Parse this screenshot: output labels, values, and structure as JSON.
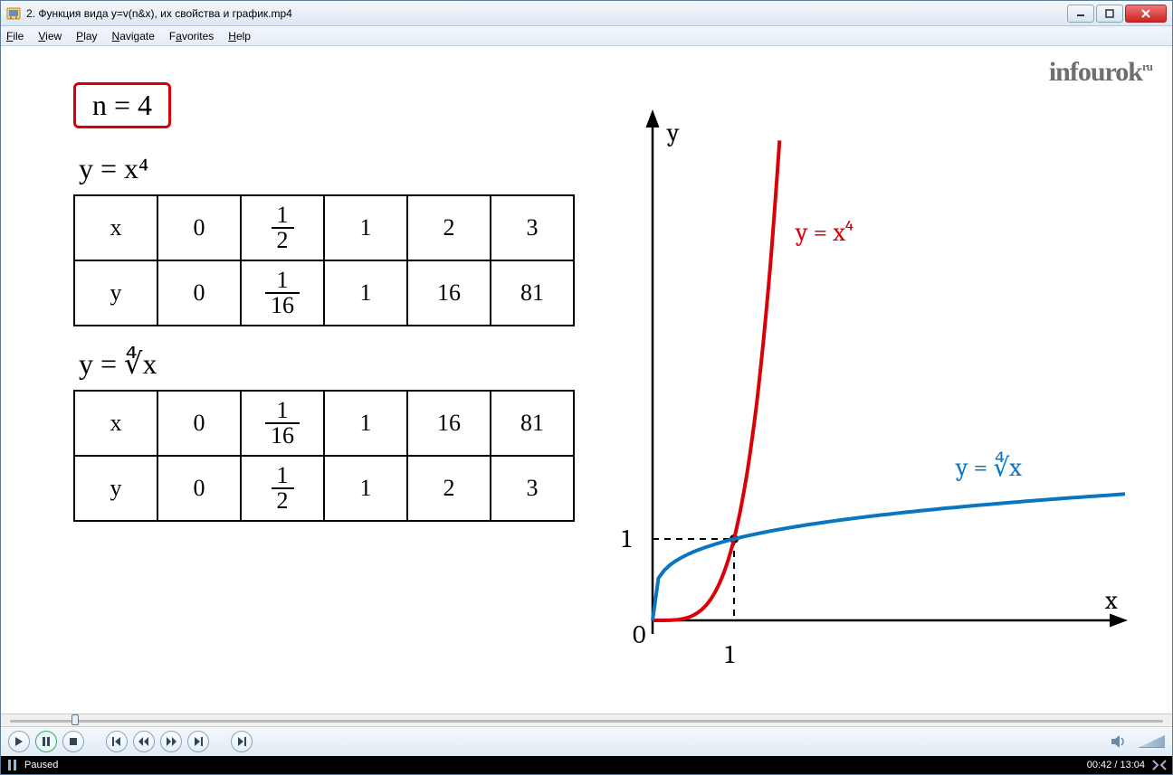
{
  "window": {
    "title": "2. Функция вида y=v(n&x), их свойства и график.mp4"
  },
  "menu": {
    "file": "File",
    "view": "View",
    "play": "Play",
    "navigate": "Navigate",
    "favorites": "Favorites",
    "help": "Help"
  },
  "brand": "infourok",
  "brand_sup": "ru",
  "lesson": {
    "n_box": "n = 4",
    "formula1": "y = x⁴",
    "formula2": "y = ∜x",
    "table1": {
      "row_x": [
        "x",
        "0",
        "1/2",
        "1",
        "2",
        "3"
      ],
      "row_y": [
        "y",
        "0",
        "1/16",
        "1",
        "16",
        "81"
      ]
    },
    "table2": {
      "row_x": [
        "x",
        "0",
        "1/16",
        "1",
        "16",
        "81"
      ],
      "row_y": [
        "y",
        "0",
        "1/2",
        "1",
        "2",
        "3"
      ]
    }
  },
  "graph": {
    "y_label": "y",
    "x_label": "x",
    "origin": "0",
    "tick1x": "1",
    "tick1y": "1",
    "curve1_label": "y = x⁴",
    "curve2_label": "y = ∜x"
  },
  "status": {
    "state": "Paused",
    "time": "00:42 / 13:04"
  },
  "seek_percent": 5.4,
  "chart_data": {
    "type": "line",
    "title": "",
    "xlabel": "x",
    "ylabel": "y",
    "series": [
      {
        "name": "y = x^4",
        "color": "#d9000a",
        "x": [
          0,
          0.25,
          0.5,
          0.75,
          1,
          1.05,
          1.1,
          1.15
        ],
        "y": [
          0,
          0.0039,
          0.0625,
          0.3164,
          1,
          1.2155,
          1.4641,
          1.749
        ]
      },
      {
        "name": "y = x^(1/4)",
        "color": "#0a76c2",
        "x": [
          0,
          0.0625,
          0.25,
          0.5,
          1,
          2,
          4,
          6,
          8
        ],
        "y": [
          0,
          0.5,
          0.7071,
          0.8409,
          1,
          1.1892,
          1.4142,
          1.5651,
          1.6818
        ]
      }
    ],
    "xlim": [
      0,
      8
    ],
    "ylim": [
      0,
      8
    ],
    "annotations": [
      {
        "label": "y = x^4",
        "x": 1.1,
        "y": 6,
        "color": "#d9000a"
      },
      {
        "label": "y = ∜x",
        "x": 6.5,
        "y": 1.6,
        "color": "#0a76c2"
      },
      {
        "label": "1",
        "x": 1,
        "y": 0,
        "axis": "x"
      },
      {
        "label": "1",
        "x": 0,
        "y": 1,
        "axis": "y"
      }
    ]
  }
}
